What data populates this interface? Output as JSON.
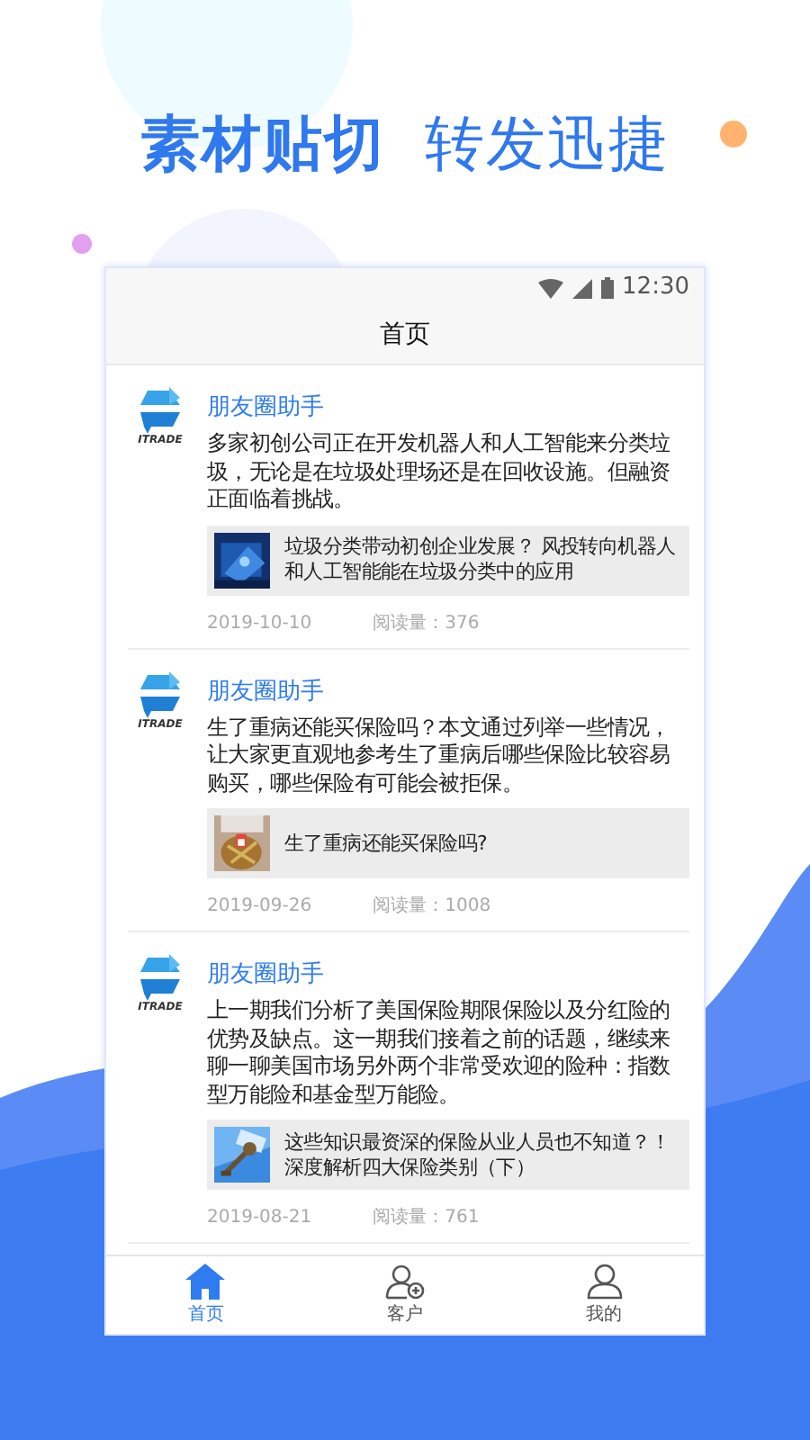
{
  "headline": [
    "素材贴切",
    "转发迅捷"
  ],
  "status_bar": {
    "time": "12:30"
  },
  "header": {
    "title": "首页"
  },
  "posts": [
    {
      "logo_text": "ITRADE",
      "author": "朋友圈助手",
      "body": "多家初创公司正在开发机器人和人工智能来分类垃圾，无论是在垃圾处理场还是在回收设施。但融资正面临着挑战。",
      "link": {
        "kind": "picture",
        "text": "垃圾分类带动初创企业发展？ 风投转向机器人和人工智能能在垃圾分类中的应用"
      },
      "date": "2019-10-10",
      "reads": "阅读量：376"
    },
    {
      "logo_text": "ITRADE",
      "author": "朋友圈助手",
      "body": "生了重病还能买保险吗？本文通过列举一些情况，让大家更直观地参考生了重病后哪些保险比较容易购买，哪些保险有可能会被拒保。",
      "link": {
        "kind": "picture",
        "text": "生了重病还能买保险吗?"
      },
      "date": "2019-09-26",
      "reads": "阅读量：1008"
    },
    {
      "logo_text": "ITRADE",
      "author": "朋友圈助手",
      "body": "上一期我们分析了美国保险期限保险以及分红险的优势及缺点。这一期我们接着之前的话题，继续来聊一聊美国市场另外两个非常受欢迎的险种：指数型万能险和基金型万能险。",
      "link": {
        "kind": "picture",
        "text": "这些知识最资深的保险从业人员也不知道？！深度解析四大保险类别（下）"
      },
      "date": "2019-08-21",
      "reads": "阅读量：761"
    }
  ],
  "tab_bar": [
    {
      "kind": "home",
      "label": "首页",
      "selected": true
    },
    {
      "kind": "client",
      "label": "客户",
      "selected": false
    },
    {
      "kind": "profile",
      "label": "我的",
      "selected": false
    }
  ]
}
